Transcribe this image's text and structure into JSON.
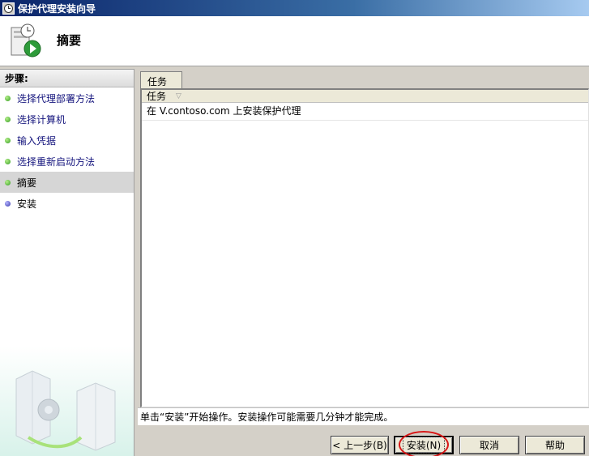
{
  "window": {
    "title": "保护代理安装向导"
  },
  "header": {
    "heading": "摘要"
  },
  "steps": {
    "heading": "步骤:",
    "items": [
      {
        "label": "选择代理部署方法",
        "status": "green"
      },
      {
        "label": "选择计算机",
        "status": "green"
      },
      {
        "label": "输入凭据",
        "status": "green"
      },
      {
        "label": "选择重新启动方法",
        "status": "green"
      },
      {
        "label": "摘要",
        "status": "green",
        "active": true
      },
      {
        "label": "安装",
        "status": "blue"
      }
    ]
  },
  "tabs": [
    {
      "label": "任务"
    }
  ],
  "task_list": {
    "column_header": "任务",
    "rows": [
      "在 V.contoso.com 上安装保护代理"
    ]
  },
  "status_text": "单击“安装”开始操作。安装操作可能需要几分钟才能完成。",
  "buttons": {
    "back": "< 上一步(B)",
    "install": "安装(N)",
    "cancel": "取消",
    "help": "帮助"
  },
  "colors": {
    "title_bar": "#0a246a",
    "step_link": "#14147d",
    "step_done": "#2f9a1f",
    "step_pending": "#3333aa",
    "highlight": "#d81818"
  }
}
